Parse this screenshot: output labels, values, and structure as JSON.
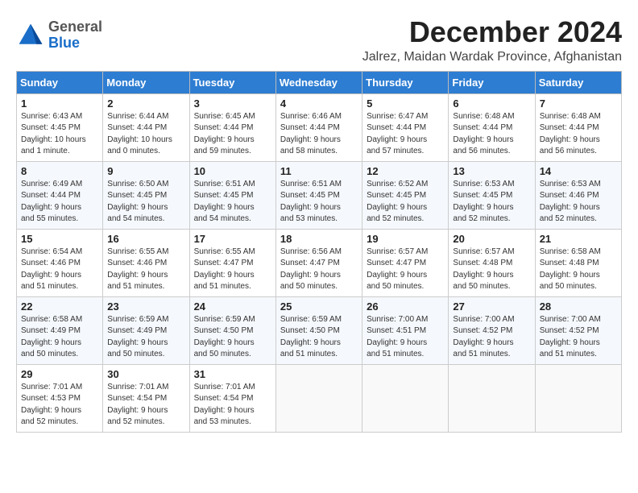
{
  "header": {
    "logo_general": "General",
    "logo_blue": "Blue",
    "month_title": "December 2024",
    "subtitle": "Jalrez, Maidan Wardak Province, Afghanistan"
  },
  "weekdays": [
    "Sunday",
    "Monday",
    "Tuesday",
    "Wednesday",
    "Thursday",
    "Friday",
    "Saturday"
  ],
  "weeks": [
    [
      {
        "day": "1",
        "info": "Sunrise: 6:43 AM\nSunset: 4:45 PM\nDaylight: 10 hours\nand 1 minute."
      },
      {
        "day": "2",
        "info": "Sunrise: 6:44 AM\nSunset: 4:44 PM\nDaylight: 10 hours\nand 0 minutes."
      },
      {
        "day": "3",
        "info": "Sunrise: 6:45 AM\nSunset: 4:44 PM\nDaylight: 9 hours\nand 59 minutes."
      },
      {
        "day": "4",
        "info": "Sunrise: 6:46 AM\nSunset: 4:44 PM\nDaylight: 9 hours\nand 58 minutes."
      },
      {
        "day": "5",
        "info": "Sunrise: 6:47 AM\nSunset: 4:44 PM\nDaylight: 9 hours\nand 57 minutes."
      },
      {
        "day": "6",
        "info": "Sunrise: 6:48 AM\nSunset: 4:44 PM\nDaylight: 9 hours\nand 56 minutes."
      },
      {
        "day": "7",
        "info": "Sunrise: 6:48 AM\nSunset: 4:44 PM\nDaylight: 9 hours\nand 56 minutes."
      }
    ],
    [
      {
        "day": "8",
        "info": "Sunrise: 6:49 AM\nSunset: 4:44 PM\nDaylight: 9 hours\nand 55 minutes."
      },
      {
        "day": "9",
        "info": "Sunrise: 6:50 AM\nSunset: 4:45 PM\nDaylight: 9 hours\nand 54 minutes."
      },
      {
        "day": "10",
        "info": "Sunrise: 6:51 AM\nSunset: 4:45 PM\nDaylight: 9 hours\nand 54 minutes."
      },
      {
        "day": "11",
        "info": "Sunrise: 6:51 AM\nSunset: 4:45 PM\nDaylight: 9 hours\nand 53 minutes."
      },
      {
        "day": "12",
        "info": "Sunrise: 6:52 AM\nSunset: 4:45 PM\nDaylight: 9 hours\nand 52 minutes."
      },
      {
        "day": "13",
        "info": "Sunrise: 6:53 AM\nSunset: 4:45 PM\nDaylight: 9 hours\nand 52 minutes."
      },
      {
        "day": "14",
        "info": "Sunrise: 6:53 AM\nSunset: 4:46 PM\nDaylight: 9 hours\nand 52 minutes."
      }
    ],
    [
      {
        "day": "15",
        "info": "Sunrise: 6:54 AM\nSunset: 4:46 PM\nDaylight: 9 hours\nand 51 minutes."
      },
      {
        "day": "16",
        "info": "Sunrise: 6:55 AM\nSunset: 4:46 PM\nDaylight: 9 hours\nand 51 minutes."
      },
      {
        "day": "17",
        "info": "Sunrise: 6:55 AM\nSunset: 4:47 PM\nDaylight: 9 hours\nand 51 minutes."
      },
      {
        "day": "18",
        "info": "Sunrise: 6:56 AM\nSunset: 4:47 PM\nDaylight: 9 hours\nand 50 minutes."
      },
      {
        "day": "19",
        "info": "Sunrise: 6:57 AM\nSunset: 4:47 PM\nDaylight: 9 hours\nand 50 minutes."
      },
      {
        "day": "20",
        "info": "Sunrise: 6:57 AM\nSunset: 4:48 PM\nDaylight: 9 hours\nand 50 minutes."
      },
      {
        "day": "21",
        "info": "Sunrise: 6:58 AM\nSunset: 4:48 PM\nDaylight: 9 hours\nand 50 minutes."
      }
    ],
    [
      {
        "day": "22",
        "info": "Sunrise: 6:58 AM\nSunset: 4:49 PM\nDaylight: 9 hours\nand 50 minutes."
      },
      {
        "day": "23",
        "info": "Sunrise: 6:59 AM\nSunset: 4:49 PM\nDaylight: 9 hours\nand 50 minutes."
      },
      {
        "day": "24",
        "info": "Sunrise: 6:59 AM\nSunset: 4:50 PM\nDaylight: 9 hours\nand 50 minutes."
      },
      {
        "day": "25",
        "info": "Sunrise: 6:59 AM\nSunset: 4:50 PM\nDaylight: 9 hours\nand 51 minutes."
      },
      {
        "day": "26",
        "info": "Sunrise: 7:00 AM\nSunset: 4:51 PM\nDaylight: 9 hours\nand 51 minutes."
      },
      {
        "day": "27",
        "info": "Sunrise: 7:00 AM\nSunset: 4:52 PM\nDaylight: 9 hours\nand 51 minutes."
      },
      {
        "day": "28",
        "info": "Sunrise: 7:00 AM\nSunset: 4:52 PM\nDaylight: 9 hours\nand 51 minutes."
      }
    ],
    [
      {
        "day": "29",
        "info": "Sunrise: 7:01 AM\nSunset: 4:53 PM\nDaylight: 9 hours\nand 52 minutes."
      },
      {
        "day": "30",
        "info": "Sunrise: 7:01 AM\nSunset: 4:54 PM\nDaylight: 9 hours\nand 52 minutes."
      },
      {
        "day": "31",
        "info": "Sunrise: 7:01 AM\nSunset: 4:54 PM\nDaylight: 9 hours\nand 53 minutes."
      },
      {
        "day": "",
        "info": ""
      },
      {
        "day": "",
        "info": ""
      },
      {
        "day": "",
        "info": ""
      },
      {
        "day": "",
        "info": ""
      }
    ]
  ]
}
